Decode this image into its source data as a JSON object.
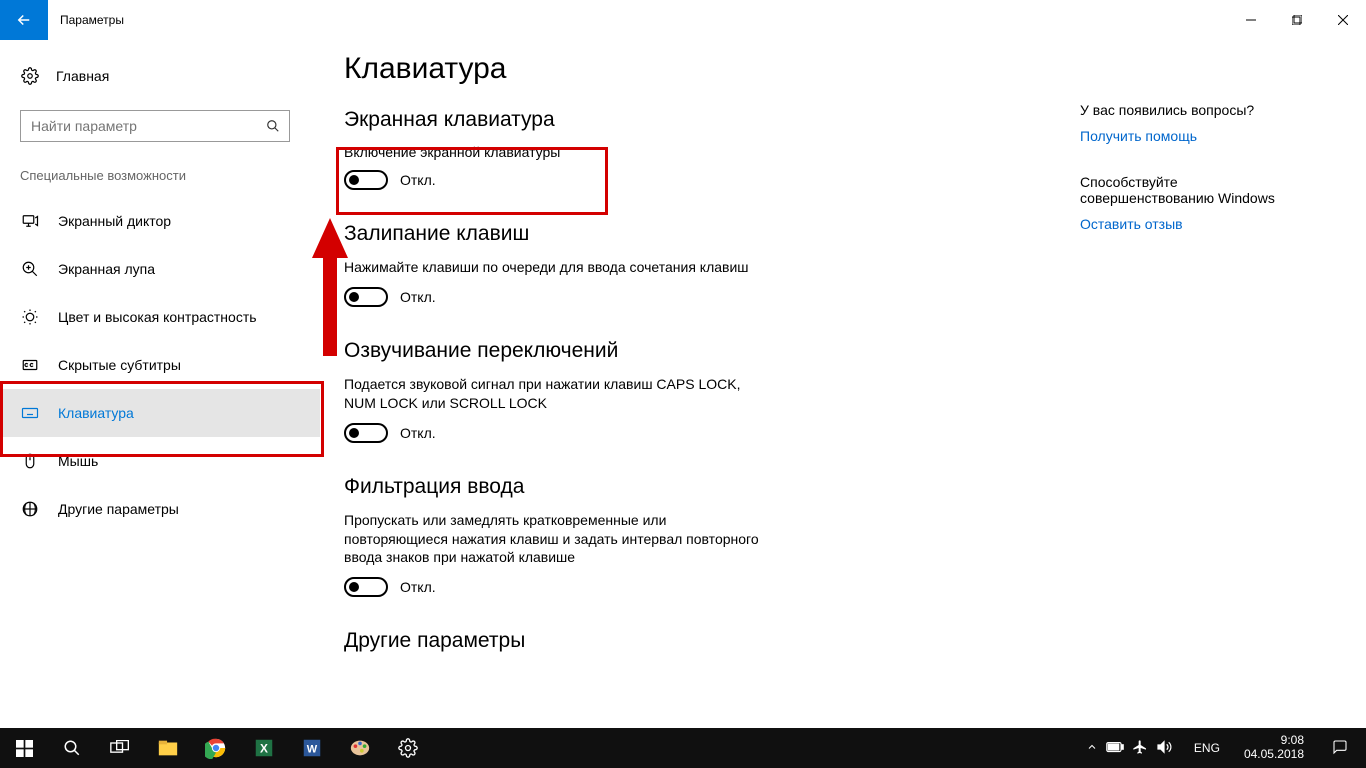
{
  "titlebar": {
    "title": "Параметры"
  },
  "sidebar": {
    "home_label": "Главная",
    "search_placeholder": "Найти параметр",
    "category_title": "Специальные возможности",
    "items": [
      {
        "label": "Экранный диктор"
      },
      {
        "label": "Экранная лупа"
      },
      {
        "label": "Цвет и высокая контрастность"
      },
      {
        "label": "Скрытые субтитры"
      },
      {
        "label": "Клавиатура"
      },
      {
        "label": "Мышь"
      },
      {
        "label": "Другие параметры"
      }
    ]
  },
  "main": {
    "page_title": "Клавиатура",
    "sections": {
      "osk": {
        "title": "Экранная клавиатура",
        "label": "Включение экранной клавиатуры",
        "state": "Откл."
      },
      "sticky": {
        "title": "Залипание клавиш",
        "desc": "Нажимайте клавиши по очереди для ввода сочетания клавиш",
        "state": "Откл."
      },
      "toggle_sound": {
        "title": "Озвучивание переключений",
        "desc": "Подается звуковой сигнал при нажатии клавиш CAPS LOCK, NUM LOCK или SCROLL LOCK",
        "state": "Откл."
      },
      "filter": {
        "title": "Фильтрация ввода",
        "desc": "Пропускать или замедлять кратковременные или повторяющиеся нажатия клавиш и задать интервал повторного ввода знаков при нажатой клавише",
        "state": "Откл."
      },
      "other": {
        "title": "Другие параметры"
      }
    }
  },
  "rail": {
    "help_title": "У вас появились вопросы?",
    "help_link": "Получить помощь",
    "improve_title": "Способствуйте совершенствованию Windows",
    "improve_link": "Оставить отзыв"
  },
  "taskbar": {
    "lang": "ENG",
    "time": "9:08",
    "date": "04.05.2018"
  }
}
